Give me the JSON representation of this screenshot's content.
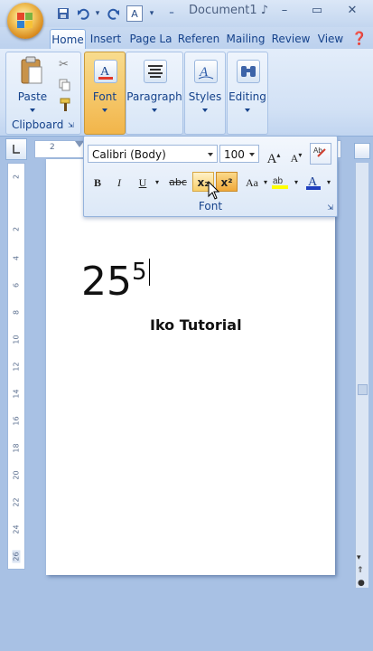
{
  "window": {
    "title": "Document1 ♪"
  },
  "quick_access": {
    "save_icon": "save-icon",
    "undo_icon": "undo-icon",
    "redo_icon": "redo-icon",
    "format_glyph": "A",
    "more_glyph": "⁼"
  },
  "window_controls": {
    "minimize": "–",
    "maximize": "▭",
    "close": "✕"
  },
  "tabs": [
    {
      "label": "Home"
    },
    {
      "label": "Insert"
    },
    {
      "label": "Page La"
    },
    {
      "label": "Referen"
    },
    {
      "label": "Mailing"
    },
    {
      "label": "Review"
    },
    {
      "label": "View"
    }
  ],
  "ribbon": {
    "paste_label": "Paste",
    "clipboard_label": "Clipboard",
    "font_label": "Font",
    "paragraph_label": "Paragraph",
    "styles_label": "Styles",
    "editing_label": "Editing"
  },
  "ruler": {
    "h_marker": "2",
    "v_ticks": [
      "2",
      "2",
      "4",
      "6",
      "8",
      "10",
      "12",
      "14",
      "16",
      "18",
      "20",
      "22",
      "24",
      "26"
    ]
  },
  "font_toolbar": {
    "font_name": "Calibri (Body)",
    "font_size": "100",
    "grow": "A",
    "shrink": "A",
    "bold": "B",
    "italic": "I",
    "underline": "U",
    "strikethrough": "abc",
    "subscript": "x₂",
    "superscript": "x²",
    "change_case": "Aa",
    "group_label": "Font"
  },
  "document": {
    "base_text": "25",
    "superscript_text": "5",
    "watermark": "Iko Tutorial"
  },
  "colors": {
    "accent": "#15428b",
    "highlight": "#f8cf6a",
    "font_color_bar": "#1f3fbf",
    "highlight_bar": "#ffff00"
  }
}
